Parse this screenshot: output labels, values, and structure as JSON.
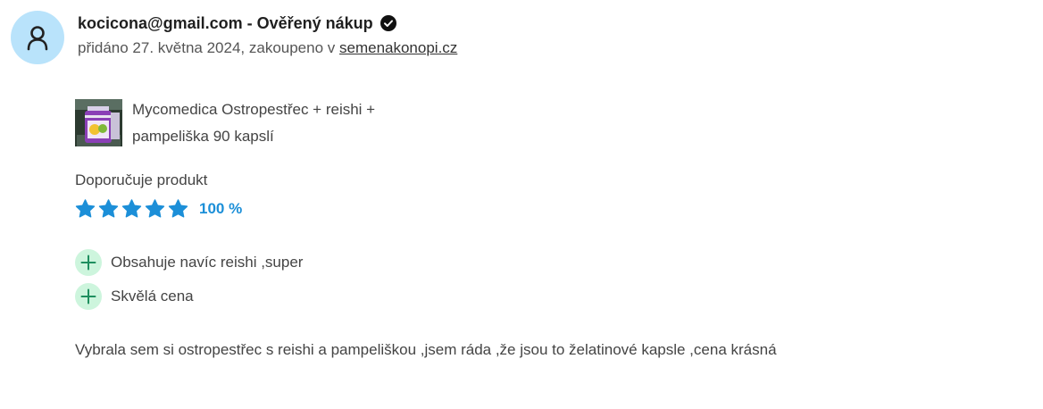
{
  "header": {
    "user_email": "kocicona@gmail.com",
    "separator": " - ",
    "verified_label": "Ověřený nákup",
    "meta_prefix": "přidáno 27. května 2024, zakoupeno v ",
    "shop_link": "semenakonopi.cz"
  },
  "icons": {
    "avatar": "user-icon",
    "verified": "check-circle-icon",
    "star": "star-icon",
    "plus": "plus-icon"
  },
  "product": {
    "name": "Mycomedica Ostropestřec + reishi + pampeliška 90 kapslí"
  },
  "rating": {
    "label": "Doporučuje produkt",
    "stars": 5,
    "stars_max": 5,
    "percent": "100 %"
  },
  "pros": [
    {
      "text": "Obsahuje navíc reishi ,super"
    },
    {
      "text": "Skvělá cena"
    }
  ],
  "review": {
    "text": "Vybrala sem si ostropestřec s reishi a pampeliškou ,jsem ráda ,že jsou to želatinové kapsle ,cena krásná"
  },
  "colors": {
    "avatar_bg": "#b9e3fb",
    "star": "#1c8fd8",
    "plus_bg": "#cdf5dd",
    "plus_fg": "#1f8f5f"
  }
}
